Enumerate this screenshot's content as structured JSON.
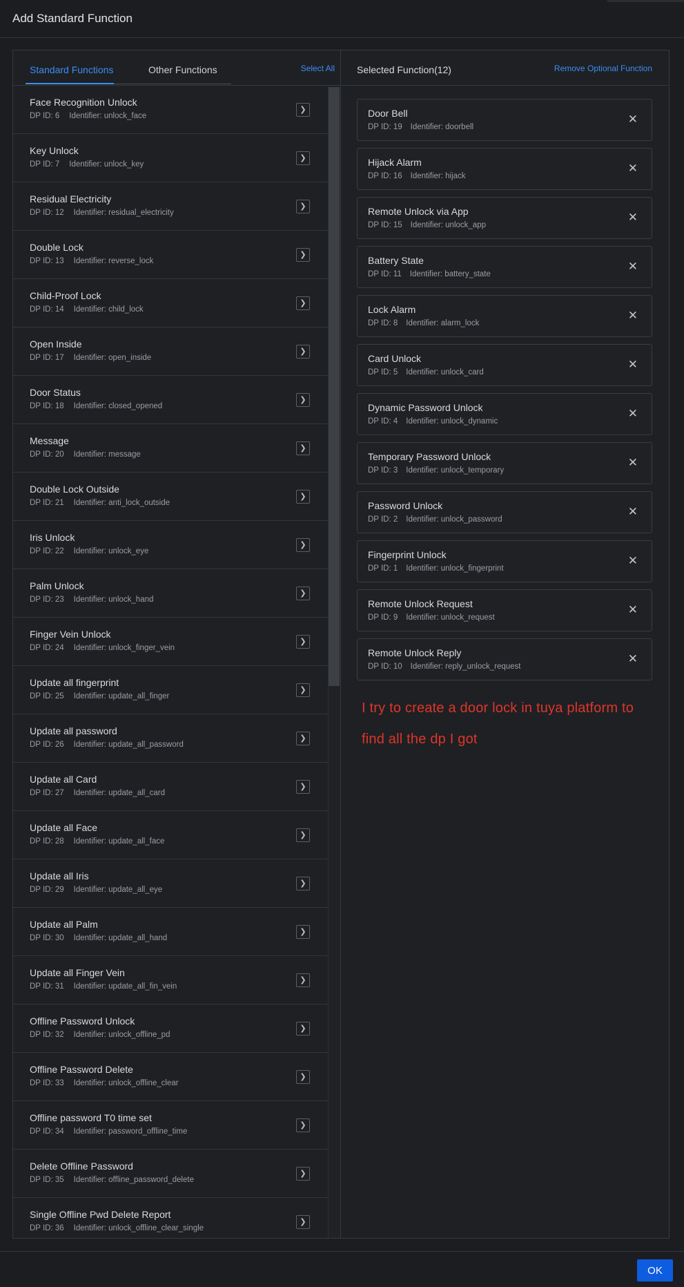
{
  "dialog": {
    "title": "Add Standard Function"
  },
  "left_panel": {
    "tabs": [
      {
        "label": "Standard Functions"
      },
      {
        "label": "Other Functions"
      }
    ],
    "select_all_label": "Select All",
    "items": [
      {
        "name": "Face Recognition Unlock",
        "dp": "DP ID: 6",
        "identifier": "Identifier: unlock_face"
      },
      {
        "name": "Key Unlock",
        "dp": "DP ID: 7",
        "identifier": "Identifier: unlock_key"
      },
      {
        "name": "Residual Electricity",
        "dp": "DP ID: 12",
        "identifier": "Identifier: residual_electricity"
      },
      {
        "name": "Double Lock",
        "dp": "DP ID: 13",
        "identifier": "Identifier: reverse_lock"
      },
      {
        "name": "Child-Proof Lock",
        "dp": "DP ID: 14",
        "identifier": "Identifier: child_lock"
      },
      {
        "name": "Open Inside",
        "dp": "DP ID: 17",
        "identifier": "Identifier: open_inside"
      },
      {
        "name": "Door Status",
        "dp": "DP ID: 18",
        "identifier": "Identifier: closed_opened"
      },
      {
        "name": "Message",
        "dp": "DP ID: 20",
        "identifier": "Identifier: message"
      },
      {
        "name": "Double Lock Outside",
        "dp": "DP ID: 21",
        "identifier": "Identifier: anti_lock_outside"
      },
      {
        "name": "Iris Unlock",
        "dp": "DP ID: 22",
        "identifier": "Identifier: unlock_eye"
      },
      {
        "name": "Palm Unlock",
        "dp": "DP ID: 23",
        "identifier": "Identifier: unlock_hand"
      },
      {
        "name": "Finger Vein Unlock",
        "dp": "DP ID: 24",
        "identifier": "Identifier: unlock_finger_vein"
      },
      {
        "name": "Update all fingerprint",
        "dp": "DP ID: 25",
        "identifier": "Identifier: update_all_finger"
      },
      {
        "name": "Update all password",
        "dp": "DP ID: 26",
        "identifier": "Identifier: update_all_password"
      },
      {
        "name": "Update all Card",
        "dp": "DP ID: 27",
        "identifier": "Identifier: update_all_card"
      },
      {
        "name": "Update all Face",
        "dp": "DP ID: 28",
        "identifier": "Identifier: update_all_face"
      },
      {
        "name": "Update all Iris",
        "dp": "DP ID: 29",
        "identifier": "Identifier: update_all_eye"
      },
      {
        "name": "Update all Palm",
        "dp": "DP ID: 30",
        "identifier": "Identifier: update_all_hand"
      },
      {
        "name": "Update all Finger Vein",
        "dp": "DP ID: 31",
        "identifier": "Identifier: update_all_fin_vein"
      },
      {
        "name": "Offline Password Unlock",
        "dp": "DP ID: 32",
        "identifier": "Identifier: unlock_offline_pd"
      },
      {
        "name": "Offline Password Delete",
        "dp": "DP ID: 33",
        "identifier": "Identifier: unlock_offline_clear"
      },
      {
        "name": "Offline password T0 time set",
        "dp": "DP ID: 34",
        "identifier": "Identifier: password_offline_time"
      },
      {
        "name": "Delete Offline Password",
        "dp": "DP ID: 35",
        "identifier": "Identifier: offline_password_delete"
      },
      {
        "name": "Single Offline Pwd Delete Report",
        "dp": "DP ID: 36",
        "identifier": "Identifier: unlock_offline_clear_single"
      }
    ]
  },
  "right_panel": {
    "title": "Selected Function(12)",
    "remove_optional_label": "Remove Optional Function",
    "items": [
      {
        "name": "Door Bell",
        "dp": "DP ID: 19",
        "identifier": "Identifier: doorbell"
      },
      {
        "name": "Hijack Alarm",
        "dp": "DP ID: 16",
        "identifier": "Identifier: hijack"
      },
      {
        "name": "Remote Unlock via App",
        "dp": "DP ID: 15",
        "identifier": "Identifier: unlock_app"
      },
      {
        "name": "Battery State",
        "dp": "DP ID: 11",
        "identifier": "Identifier: battery_state"
      },
      {
        "name": "Lock Alarm",
        "dp": "DP ID: 8",
        "identifier": "Identifier: alarm_lock"
      },
      {
        "name": "Card Unlock",
        "dp": "DP ID: 5",
        "identifier": "Identifier: unlock_card"
      },
      {
        "name": "Dynamic Password Unlock",
        "dp": "DP ID: 4",
        "identifier": "Identifier: unlock_dynamic"
      },
      {
        "name": "Temporary Password Unlock",
        "dp": "DP ID: 3",
        "identifier": "Identifier: unlock_temporary"
      },
      {
        "name": "Password Unlock",
        "dp": "DP ID: 2",
        "identifier": "Identifier: unlock_password"
      },
      {
        "name": "Fingerprint Unlock",
        "dp": "DP ID: 1",
        "identifier": "Identifier: unlock_fingerprint"
      },
      {
        "name": "Remote Unlock Request",
        "dp": "DP ID: 9",
        "identifier": "Identifier: unlock_request"
      },
      {
        "name": "Remote Unlock Reply",
        "dp": "DP ID: 10",
        "identifier": "Identifier: reply_unlock_request"
      }
    ],
    "annotation": "I try to create a door lock in tuya platform to find all the dp I got"
  },
  "footer": {
    "ok_label": "OK"
  },
  "icons": {
    "add": "chevron-right-icon",
    "remove": "close-icon"
  },
  "colors": {
    "accent": "#3d8df5",
    "primary_button": "#0e5ce0",
    "annotation": "#e0352b",
    "background": "#1b1d20"
  }
}
